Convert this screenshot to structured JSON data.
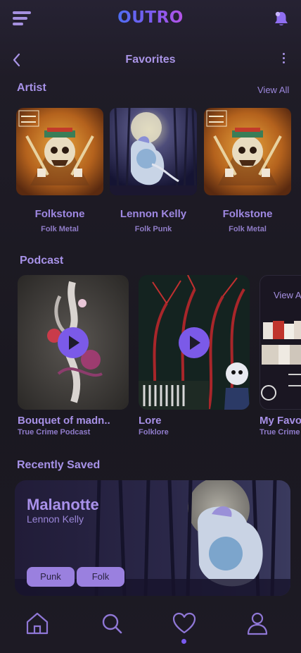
{
  "app": {
    "logo": "OUTRO"
  },
  "header": {
    "title": "Favorites"
  },
  "artists": {
    "section_title": "Artist",
    "view_all": "View All",
    "items": [
      {
        "name": "Folkstone",
        "genre": "Folk Metal"
      },
      {
        "name": "Lennon Kelly",
        "genre": "Folk Punk"
      },
      {
        "name": "Folkstone",
        "genre": "Folk Metal"
      }
    ]
  },
  "podcasts": {
    "section_title": "Podcast",
    "items": [
      {
        "title": "Bouquet of madn..",
        "subtitle": "True Crime Podcast"
      },
      {
        "title": "Lore",
        "subtitle": "Folklore"
      },
      {
        "title": "My Favo",
        "subtitle": "True Crime",
        "overlay_text": "View A"
      }
    ]
  },
  "recently_saved": {
    "section_title": "Recently Saved",
    "title": "Malanotte",
    "artist": "Lennon Kelly",
    "tags": [
      "Punk",
      "Folk"
    ]
  },
  "bottom_nav": {
    "items": [
      "home-icon",
      "search-icon",
      "heart-icon",
      "profile-icon"
    ],
    "active": "heart-icon"
  },
  "colors": {
    "accent": "#7b5ae8",
    "text_primary": "#a792e8",
    "background": "#1c1a22",
    "tag_bg": "#9a80df"
  }
}
